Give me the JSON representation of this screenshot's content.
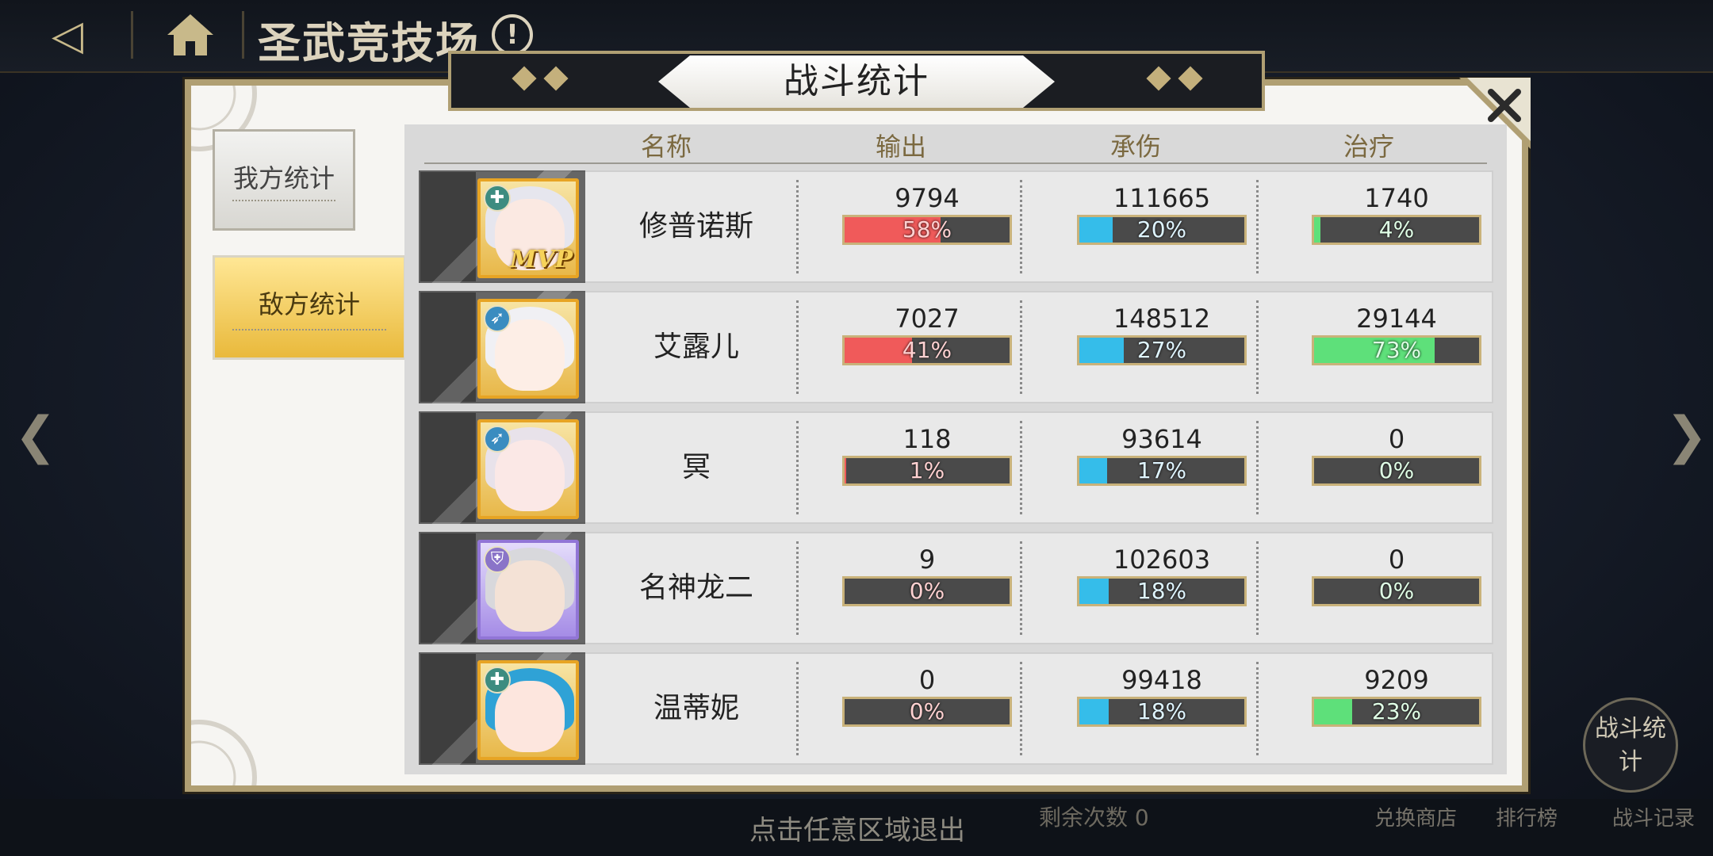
{
  "top_bar": {
    "title": "圣武竞技场",
    "info_icon": "!"
  },
  "dialog": {
    "title": "战斗统计",
    "tabs": [
      {
        "label": "我方统计",
        "selected": false
      },
      {
        "label": "敌方统计",
        "selected": true
      }
    ],
    "columns": [
      "名称",
      "输出",
      "承伤",
      "治疗"
    ],
    "rows": [
      {
        "name": "修普诺斯",
        "frame": "gold",
        "role": "healer",
        "mvp": "MVP",
        "damage": "9794",
        "damage_pct": "58%",
        "damage_frac": 0.58,
        "taken": "111665",
        "taken_pct": "20%",
        "taken_frac": 0.2,
        "heal": "1740",
        "heal_pct": "4%",
        "heal_frac": 0.04
      },
      {
        "name": "艾露儿",
        "frame": "gold",
        "role": "archer",
        "mvp": "",
        "damage": "7027",
        "damage_pct": "41%",
        "damage_frac": 0.41,
        "taken": "148512",
        "taken_pct": "27%",
        "taken_frac": 0.27,
        "heal": "29144",
        "heal_pct": "73%",
        "heal_frac": 0.73
      },
      {
        "name": "冥",
        "frame": "gold",
        "role": "archer",
        "mvp": "",
        "damage": "118",
        "damage_pct": "1%",
        "damage_frac": 0.01,
        "taken": "93614",
        "taken_pct": "17%",
        "taken_frac": 0.17,
        "heal": "0",
        "heal_pct": "0%",
        "heal_frac": 0
      },
      {
        "name": "名神龙二",
        "frame": "purple",
        "role": "tank",
        "mvp": "",
        "damage": "9",
        "damage_pct": "0%",
        "damage_frac": 0,
        "taken": "102603",
        "taken_pct": "18%",
        "taken_frac": 0.18,
        "heal": "0",
        "heal_pct": "0%",
        "heal_frac": 0
      },
      {
        "name": "温蒂妮",
        "frame": "gold",
        "role": "healer",
        "mvp": "",
        "damage": "0",
        "damage_pct": "0%",
        "damage_frac": 0,
        "taken": "99418",
        "taken_pct": "18%",
        "taken_frac": 0.18,
        "heal": "9209",
        "heal_pct": "23%",
        "heal_frac": 0.23
      }
    ]
  },
  "footer": {
    "exit_hint": "点击任意区域退出",
    "remain": "剩余次数  0",
    "exchange": "兑换商店",
    "ranking": "排行榜",
    "battle_record": "战斗记录",
    "battle_stat": "战斗统计"
  },
  "colors": {
    "damage": "#f05a5a",
    "taken": "#35bdea",
    "heal": "#5ee07a",
    "accent": "#b09f73"
  }
}
